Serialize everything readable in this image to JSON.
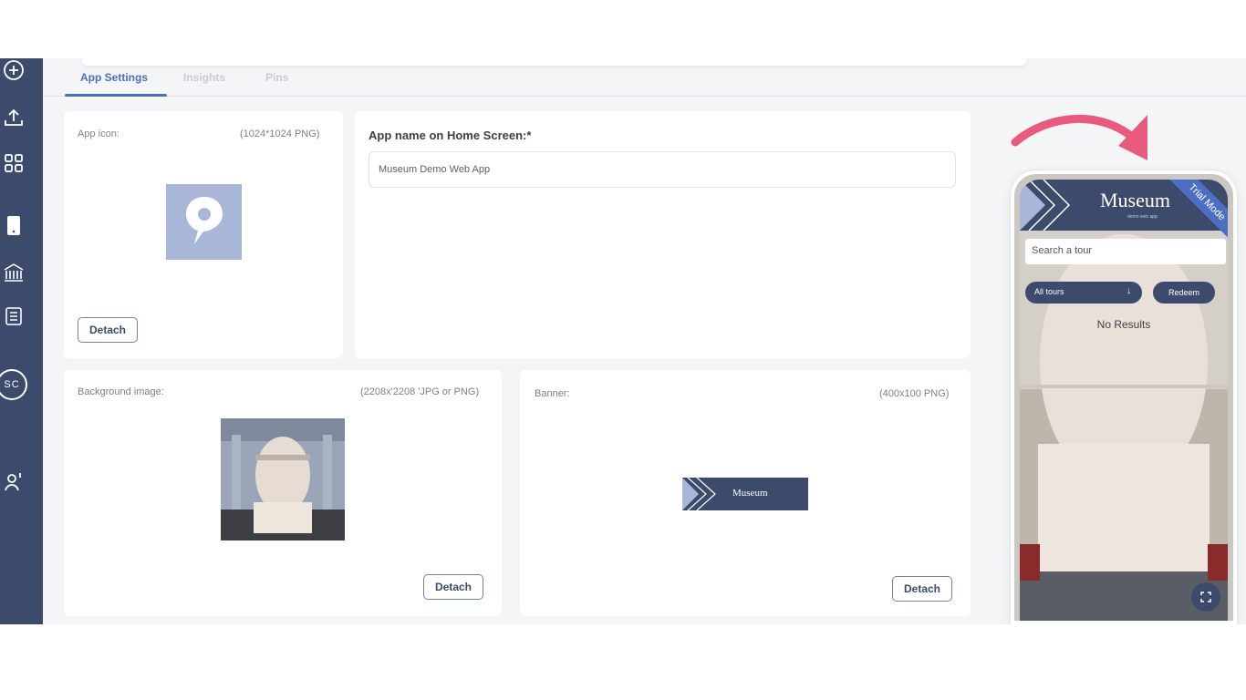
{
  "tabs": [
    {
      "label": "App Settings",
      "active": true
    },
    {
      "label": "Insights",
      "active": false
    },
    {
      "label": "Pins",
      "active": false
    }
  ],
  "sidebar": {
    "icons": [
      "add-circle-icon",
      "upload-icon",
      "apps-grid-icon",
      "phone-icon",
      "museum-icon",
      "document-icon",
      "avatar",
      "user-key-icon"
    ],
    "avatar_initials": "SC"
  },
  "app_icon_card": {
    "label": "App icon:",
    "spec": "(1024*1024 PNG)",
    "detach_label": "Detach"
  },
  "app_name_card": {
    "label": "App name on Home Screen:*",
    "value": "Museum Demo Web App"
  },
  "background_card": {
    "label": "Background image:",
    "spec": "(2208x'2208 'JPG or PNG)",
    "detach_label": "Detach"
  },
  "banner_card": {
    "label": "Banner:",
    "spec": "(400x100 PNG)",
    "detach_label": "Detach",
    "banner_text": "Museum"
  },
  "phone_preview": {
    "logo": "Museum",
    "subtitle": "demo web app",
    "ribbon": "Trial Mode",
    "search_placeholder": "Search a tour",
    "filter_selected": "All tours",
    "redeem_label": "Redeem",
    "empty_text": "No Results"
  },
  "colors": {
    "sidebar": "#3c4a6b",
    "accent": "#4d6fc3",
    "arrow": "#e85b7f"
  }
}
